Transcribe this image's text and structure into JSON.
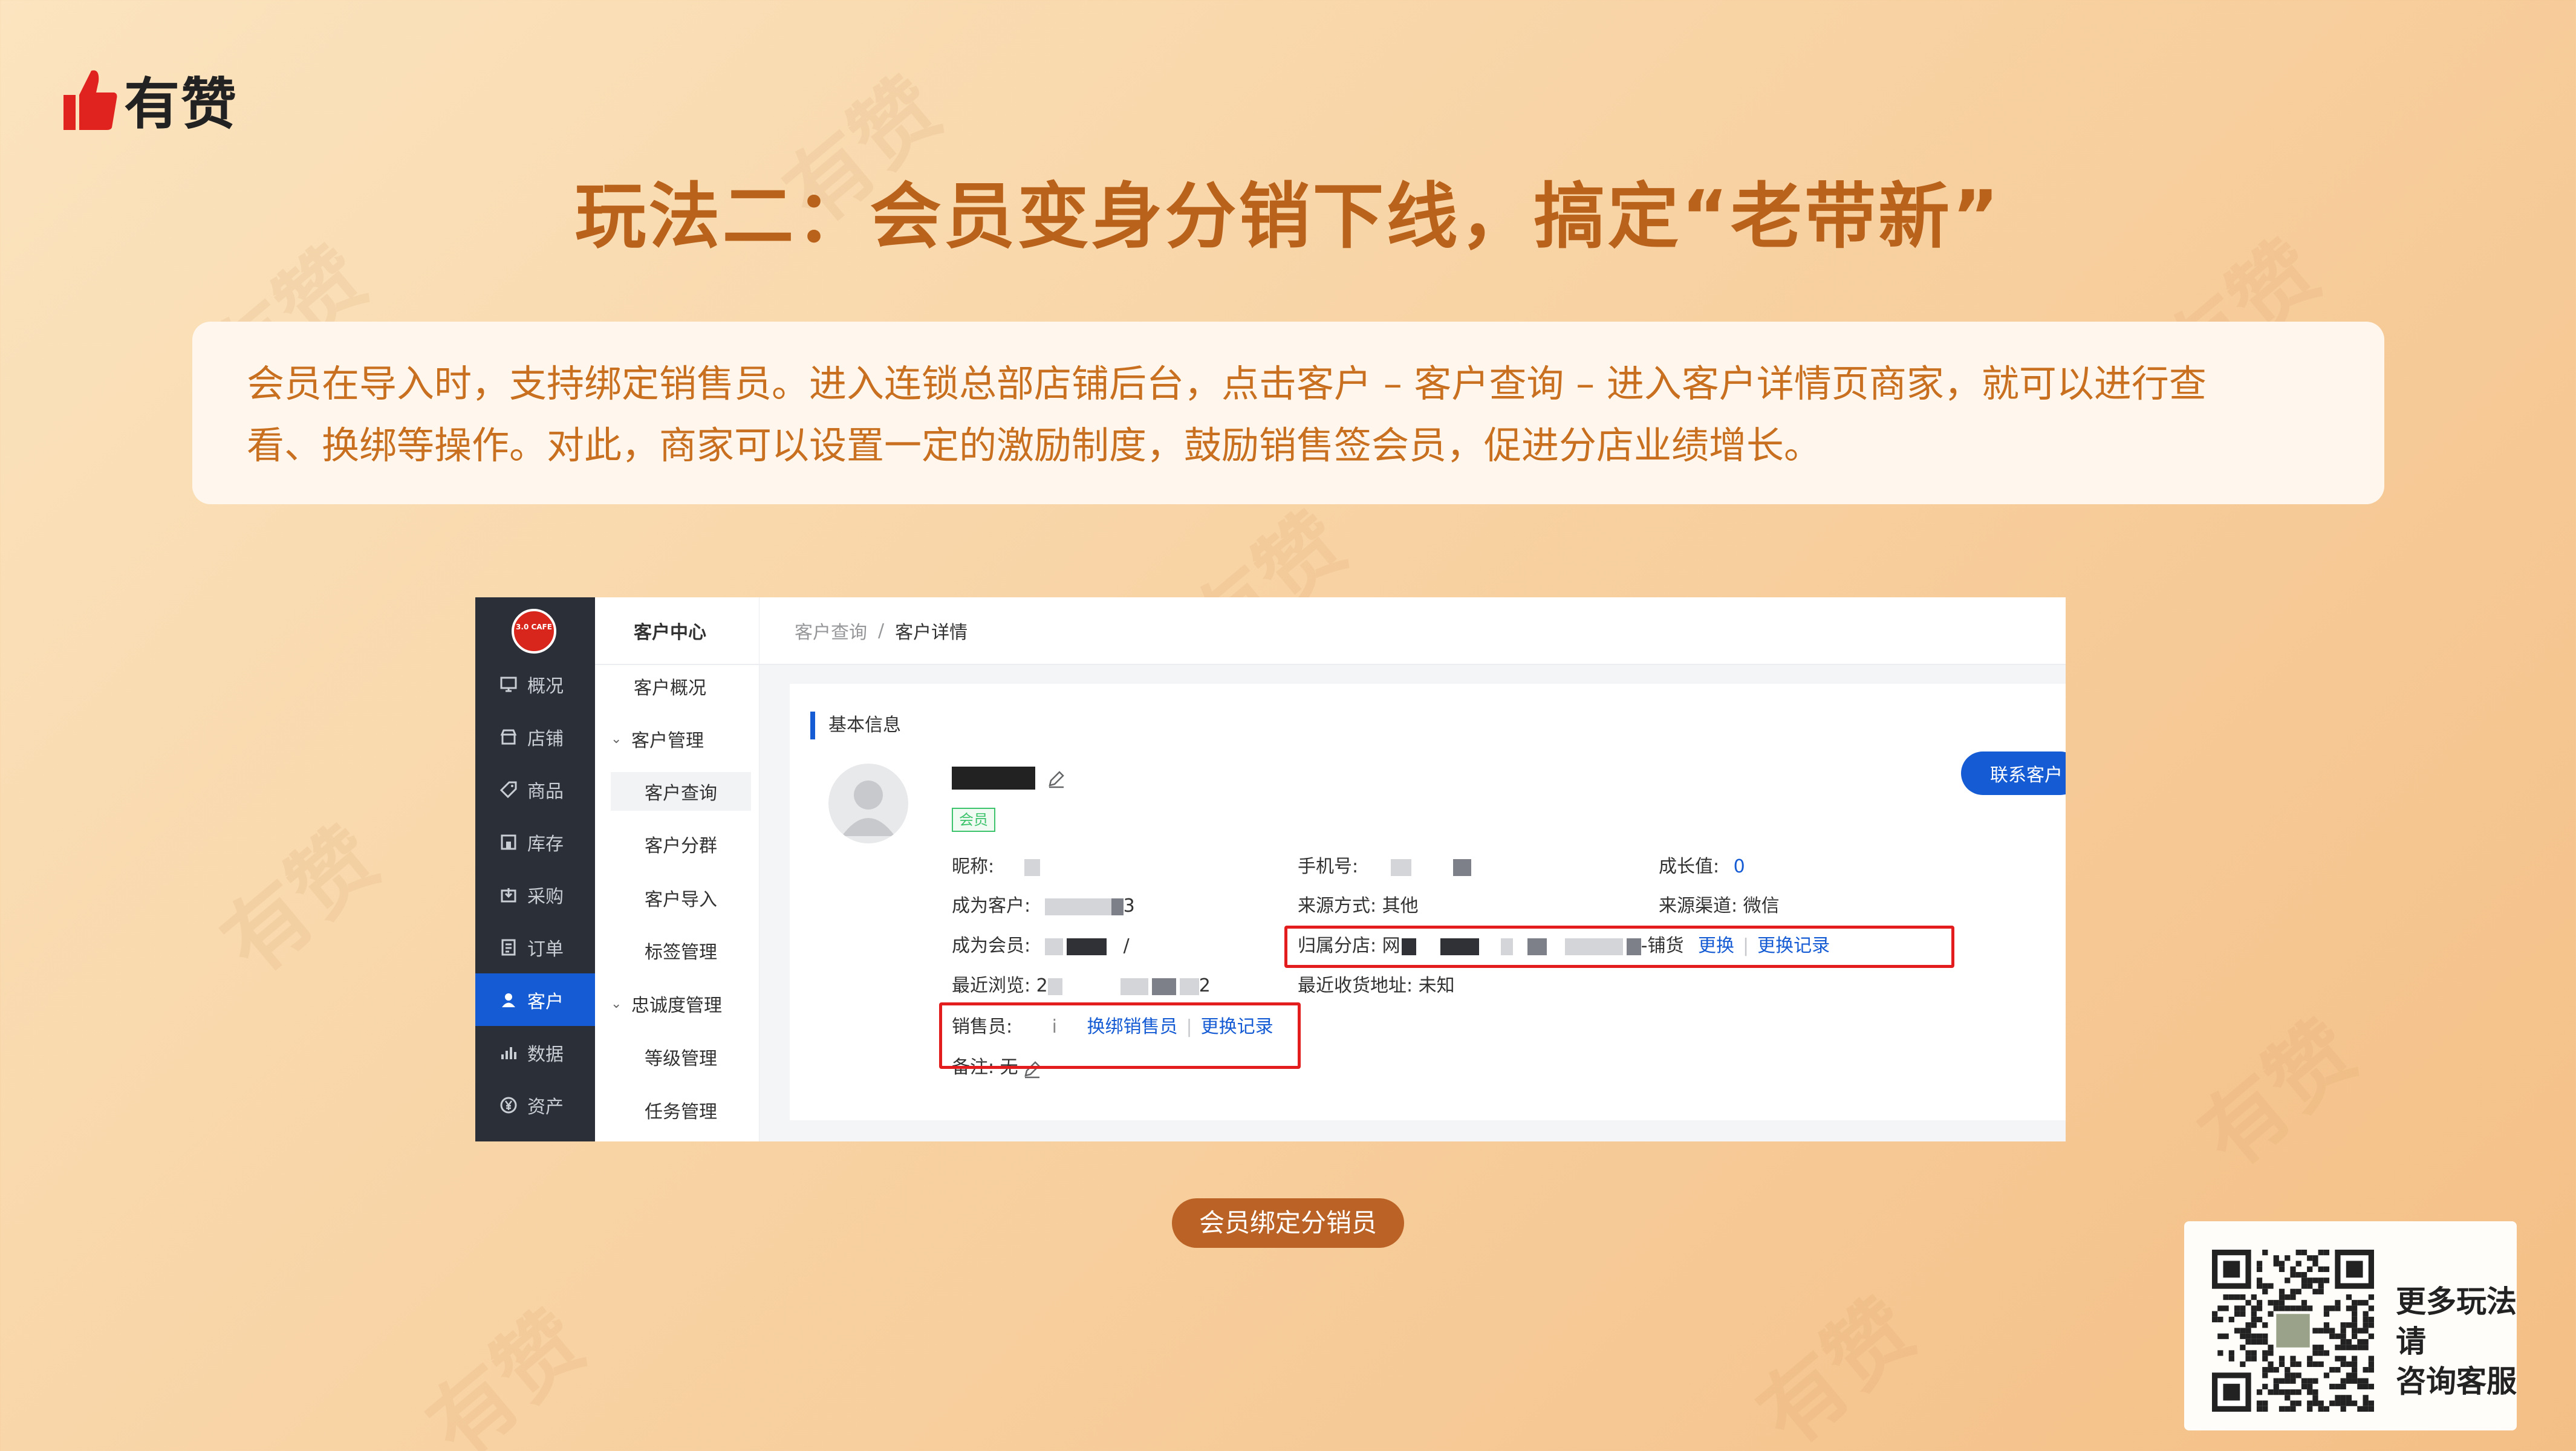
{
  "brand": {
    "name": "有赞"
  },
  "title": "玩法二：会员变身分销下线，搞定“老带新”",
  "description": {
    "line1": "会员在导入时，支持绑定销售员。进入连锁总部店铺后台，点击客户 – 客户查询 – 进入客户详情页商家，就可以进行查",
    "line2": "看、换绑等操作。对此，商家可以设置一定的激励制度，鼓励销售签会员，促进分店业绩增长。"
  },
  "screenshot": {
    "store_logo_text": "3.0 CAFE",
    "sidebar": [
      {
        "label": "概况",
        "icon": "monitor-icon"
      },
      {
        "label": "店铺",
        "icon": "store-icon"
      },
      {
        "label": "商品",
        "icon": "tag-icon"
      },
      {
        "label": "库存",
        "icon": "warehouse-icon"
      },
      {
        "label": "采购",
        "icon": "purchase-icon"
      },
      {
        "label": "订单",
        "icon": "order-icon"
      },
      {
        "label": "客户",
        "icon": "user-icon",
        "active": true
      },
      {
        "label": "数据",
        "icon": "chart-icon"
      },
      {
        "label": "资产",
        "icon": "yen-icon"
      }
    ],
    "submenu": {
      "header": "客户中心",
      "items": [
        "客户概况",
        "客户管理",
        "客户查询",
        "客户分群",
        "客户导入",
        "标签管理",
        "忠诚度管理",
        "等级管理",
        "任务管理"
      ]
    },
    "breadcrumb": {
      "parent": "客户查询",
      "separator": "/",
      "current": "客户详情"
    },
    "section_title": "基本信息",
    "member_badge": "会员",
    "contact_button": "联系客户",
    "fields": {
      "nickname_label": "昵称:",
      "phone_label": "手机号:",
      "growth_label": "成长值:",
      "growth_value": "0",
      "became_customer_label": "成为客户:",
      "became_customer_tail": "3",
      "source_method_label": "来源方式:",
      "source_method_value": "其他",
      "source_channel_label": "来源渠道:",
      "source_channel_value": "微信",
      "became_member_label": "成为会员:",
      "became_member_tail": "/",
      "branch_label": "归属分店:",
      "branch_head": "网",
      "branch_tail": "-铺货",
      "branch_change": "更换",
      "branch_history": "更换记录",
      "recent_visit_label": "最近浏览:",
      "recent_visit_head": "2",
      "recent_visit_tail": "2",
      "address_label": "最近收货地址:",
      "address_value": "未知",
      "sales_label": "销售员:",
      "sales_value": "i",
      "sales_rebind": "换绑销售员",
      "sales_history": "更换记录",
      "remark_label": "备注:",
      "remark_value": "无"
    }
  },
  "caption": "会员绑定分销员",
  "qr_card": {
    "line1": "更多玩法请",
    "line2": "咨询客服"
  },
  "colors": {
    "title": "#b9621b",
    "description": "#c8701f",
    "accent_blue": "#155bd4",
    "highlight_red": "#e31d1d",
    "caption_bg": "#bb6326"
  }
}
